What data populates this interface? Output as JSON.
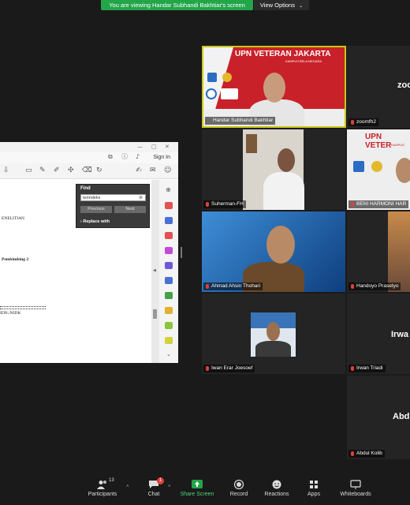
{
  "banner": {
    "text": "You are viewing Handar Subhandi Bakhtiar's screen",
    "view_options": "View Options"
  },
  "share": {
    "sign_in": "Sign In",
    "find": {
      "title": "Find",
      "query": "terindeks",
      "previous": "Previous",
      "next": "Next",
      "replace": "Replace with"
    },
    "doc": {
      "line1": "ENELITIAN",
      "line2": "Pembimbing 2",
      "line3": "IDN./NIDK"
    }
  },
  "tiles": [
    {
      "name": "Handar Subhandi Bakhtiar",
      "banner_title": "UPN VETERAN JAKARTA",
      "banner_sub": "KAMPUS BELA NEGARA"
    },
    {
      "name": "zoomfh2",
      "big": "zoo"
    },
    {
      "name": "Suherman-FH"
    },
    {
      "name": "BENI HARMONI HAR",
      "banner_title": "UPN VETER",
      "banner_sub": "KAMPUS"
    },
    {
      "name": "Ahmad Ahsin Thohari"
    },
    {
      "name": "Handoyo Prasetyo"
    },
    {
      "name": "Iwan Erar Joesoef"
    },
    {
      "name": "Irwan Triadi",
      "big": "Irwa"
    },
    {
      "name": "Abdul Kolib",
      "big": "Abd"
    }
  ],
  "toolbar": {
    "participants": "Participants",
    "participants_count": "13",
    "chat": "Chat",
    "chat_badge": "1",
    "share_screen": "Share Screen",
    "record": "Record",
    "reactions": "Reactions",
    "apps": "Apps",
    "whiteboards": "Whiteboards"
  },
  "colors": {
    "active_border": "#c9c817",
    "share_green": "#23a54a",
    "mic_red": "#e0403a"
  }
}
